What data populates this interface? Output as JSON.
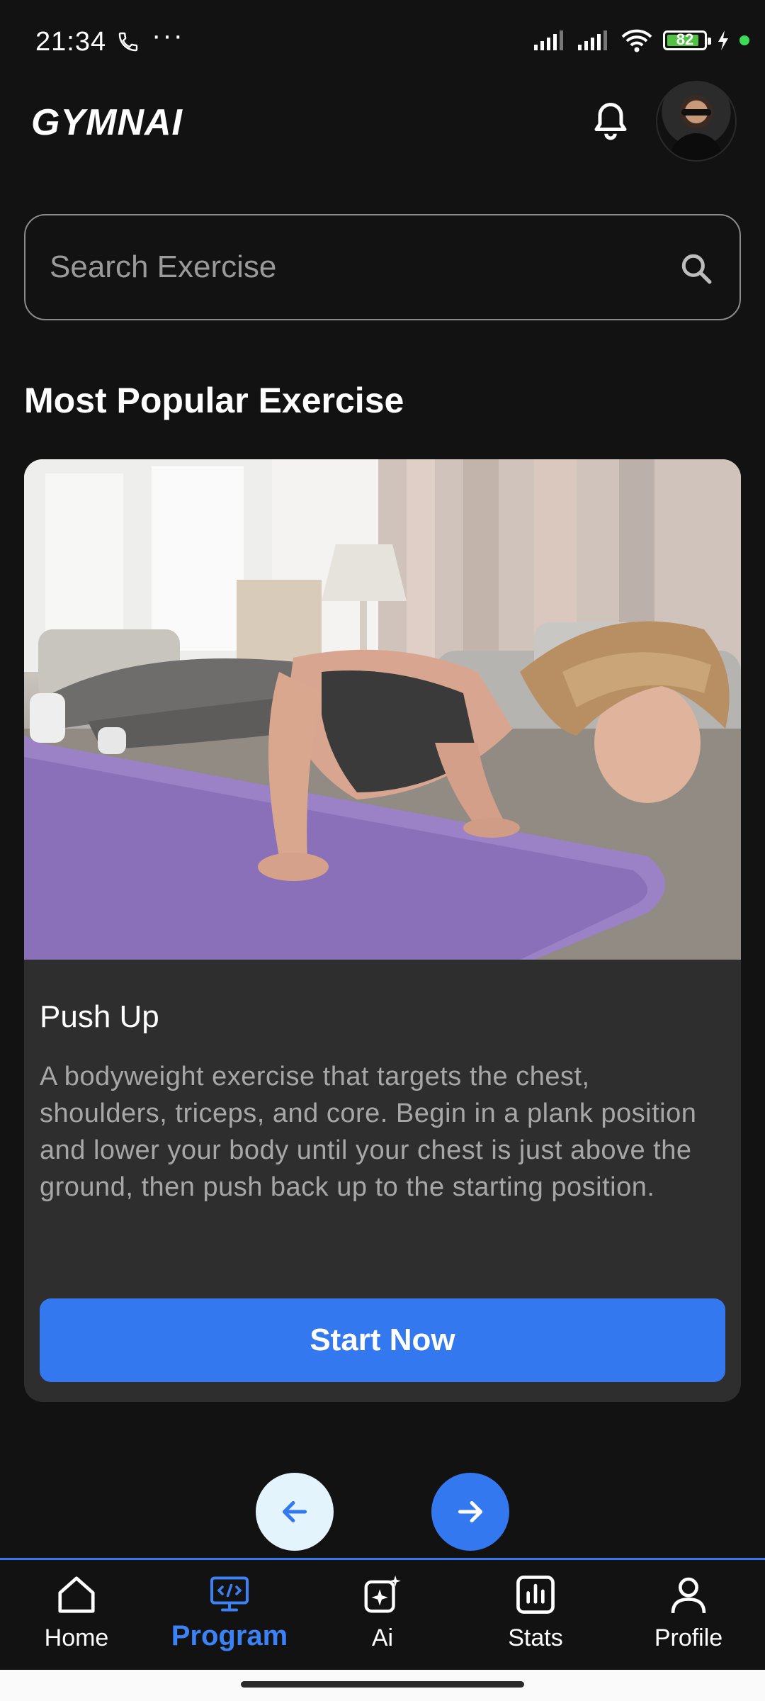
{
  "status_bar": {
    "time": "21:34",
    "battery": "82"
  },
  "header": {
    "logo": "GYMNAI"
  },
  "search": {
    "placeholder": "Search Exercise",
    "value": ""
  },
  "section": {
    "title": "Most Popular Exercise"
  },
  "exercise_card": {
    "title": "Push Up",
    "description": "A bodyweight exercise that targets the chest, shoulders, triceps, and core. Begin in a plank position and lower your body until your chest is just above the ground, then push back up to the starting position.",
    "cta_label": "Start Now",
    "image": "woman-doing-push-up-on-purple-mat"
  },
  "carousel": {
    "prev_icon": "arrow-left-icon",
    "next_icon": "arrow-right-icon"
  },
  "tabs": [
    {
      "label": "Home",
      "icon": "home-icon",
      "active": false
    },
    {
      "label": "Program",
      "icon": "program-icon",
      "active": true
    },
    {
      "label": "Ai",
      "icon": "ai-sparkle-icon",
      "active": false
    },
    {
      "label": "Stats",
      "icon": "stats-icon",
      "active": false
    },
    {
      "label": "Profile",
      "icon": "profile-icon",
      "active": false
    }
  ],
  "colors": {
    "accent": "#3478F0",
    "background": "#121212",
    "card": "#2E2E2E",
    "prev_button": "#E4F4FC"
  }
}
